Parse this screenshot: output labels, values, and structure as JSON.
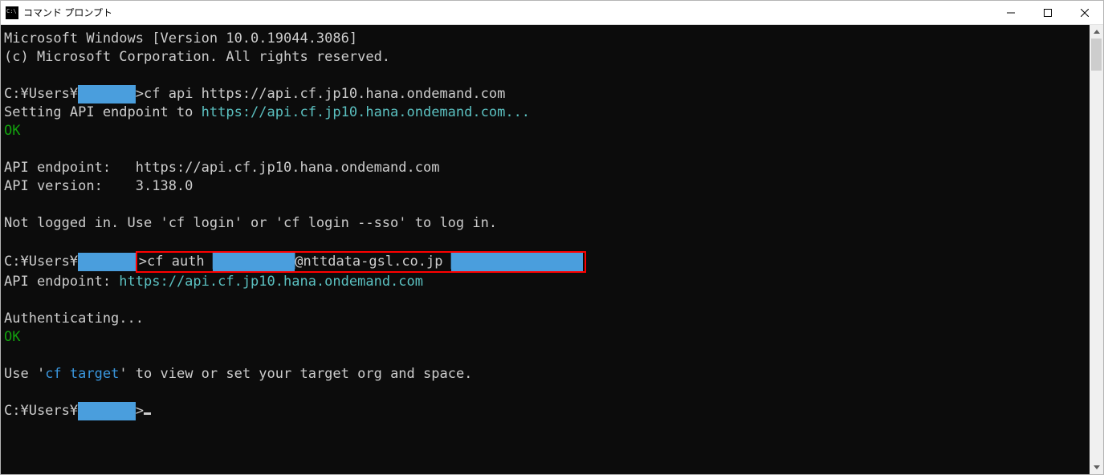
{
  "window": {
    "title": "コマンド プロンプト"
  },
  "lines": {
    "l1": "Microsoft Windows [Version 10.0.19044.3086]",
    "l2": "(c) Microsoft Corporation. All rights reserved.",
    "prompt1_before": "C:¥Users¥",
    "prompt1_redact": "███████",
    "prompt1_cmd": ">cf api https://api.cf.jp10.hana.ondemand.com",
    "setting_endpoint": "Setting API endpoint to ",
    "endpoint_url_dots": "https://api.cf.jp10.hana.ondemand.com...",
    "ok": "OK",
    "api_endpoint_label": "API endpoint:   ",
    "api_endpoint_url": "https://api.cf.jp10.hana.ondemand.com",
    "api_version": "API version:    3.138.0",
    "not_logged": "Not logged in. Use 'cf login' or 'cf login --sso' to log in.",
    "prompt2_before": "C:¥Users¥",
    "prompt2_redact": "███████",
    "auth_cmd_part1": ">cf auth ",
    "auth_redact1": "██████████",
    "auth_email_part": "@nttdata-gsl.co.jp ",
    "auth_redact2": "████████████████",
    "api_endpoint2_label": "API endpoint: ",
    "api_endpoint2_url": "https://api.cf.jp10.hana.ondemand.com",
    "authenticating": "Authenticating...",
    "use_part1": "Use '",
    "use_cmd": "cf target",
    "use_part2": "' to view or set your target org and space.",
    "prompt3_before": "C:¥Users¥",
    "prompt3_redact": "███████",
    "prompt3_after": ">"
  }
}
